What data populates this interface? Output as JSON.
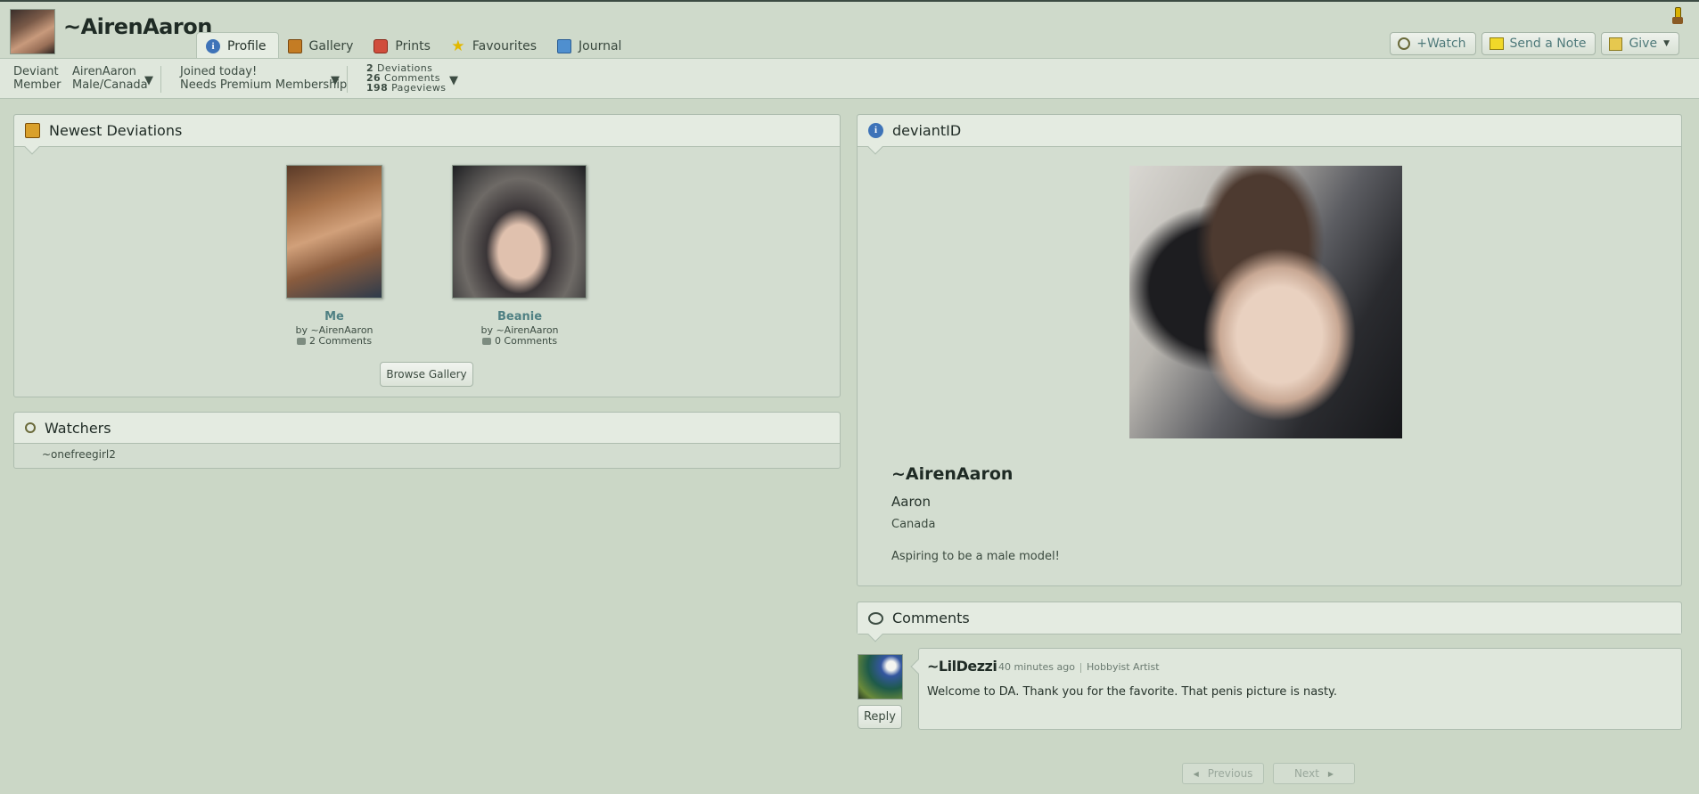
{
  "header": {
    "username": "~AirenAaron",
    "tabs": [
      {
        "label": "Profile",
        "icon": "info-icon",
        "active": true
      },
      {
        "label": "Gallery",
        "icon": "gallery-icon"
      },
      {
        "label": "Prints",
        "icon": "prints-icon"
      },
      {
        "label": "Favourites",
        "icon": "star-icon"
      },
      {
        "label": "Journal",
        "icon": "journal-icon"
      }
    ],
    "buttons": {
      "watch": "+Watch",
      "note": "Send a Note",
      "give": "Give"
    }
  },
  "subbar": {
    "member_line1": "Deviant",
    "member_line2": "Member",
    "name": "AirenAaron",
    "gender_location": "Male/Canada",
    "joined": "Joined today!",
    "membership": "Needs Premium Membership",
    "stats": [
      {
        "count": "2",
        "label": "Deviations"
      },
      {
        "count": "26",
        "label": "Comments"
      },
      {
        "count": "198",
        "label": "Pageviews"
      }
    ]
  },
  "newest": {
    "title": "Newest Deviations",
    "items": [
      {
        "title": "Me",
        "by": "by ~AirenAaron",
        "comments": "2 Comments"
      },
      {
        "title": "Beanie",
        "by": "by ~AirenAaron",
        "comments": "0 Comments"
      }
    ],
    "browse_label": "Browse Gallery"
  },
  "watchers": {
    "title": "Watchers",
    "items": [
      "~onefreegirl2"
    ]
  },
  "deviantid": {
    "title": "deviantID",
    "username": "~AirenAaron",
    "real_name": "Aaron",
    "location": "Canada",
    "bio": "Aspiring to be a male model!"
  },
  "comments": {
    "title": "Comments",
    "items": [
      {
        "user": "~LilDezzi",
        "time": "40 minutes ago",
        "role": "Hobbyist Artist",
        "text": "Welcome to DA. Thank you for the favorite. That penis picture is nasty.",
        "reply_label": "Reply"
      }
    ],
    "pager": {
      "prev": "Previous",
      "next": "Next"
    }
  },
  "colors": {
    "background": "#cbd7c6",
    "panel": "#d3ddd0",
    "link": "#4f8083",
    "text": "#1f2b25"
  }
}
